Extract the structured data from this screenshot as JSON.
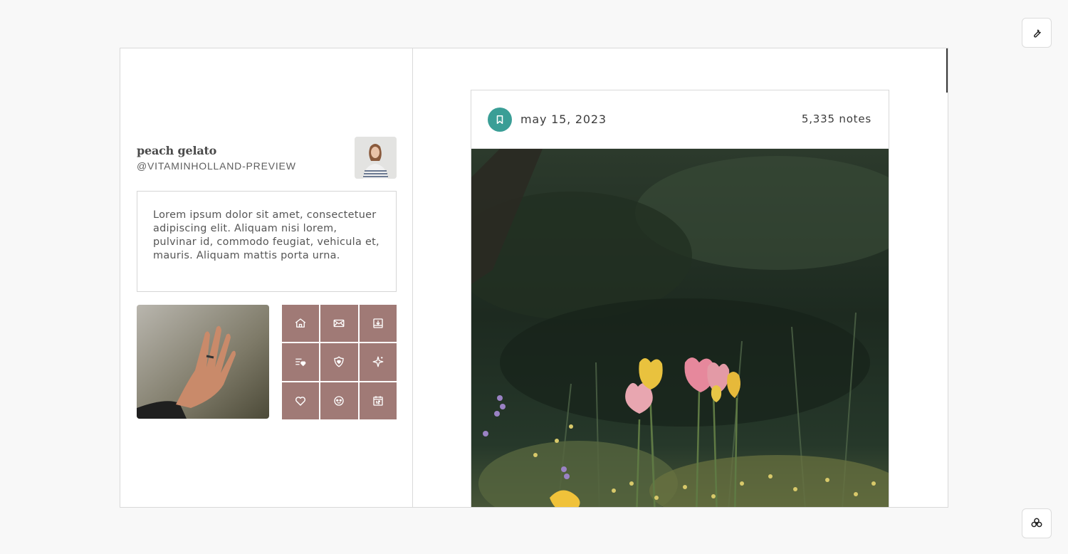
{
  "blog": {
    "title": "peach gelato",
    "handle": "@VITAMINHOLLAND-PREVIEW",
    "description": "Lorem ipsum dolor sit amet, consectetuer adipiscing elit. Aliquam nisi lorem, pulvinar id, commodo feugiat, vehicula et, mauris. Aliquam mattis porta urna."
  },
  "icon_grid": {
    "color": "#a07a76",
    "items": [
      "home-icon",
      "mail-icon",
      "archive-icon",
      "likes-list-icon",
      "heart-shield-icon",
      "sparkle-icon",
      "heart-icon",
      "face-icon",
      "calendar-icon"
    ]
  },
  "post": {
    "date": "may 15, 2023",
    "notes": "5,335 notes",
    "accent": "#3a9e96"
  },
  "floating": {
    "top_icon": "wrench-icon",
    "bottom_icon": "flower-icon"
  }
}
